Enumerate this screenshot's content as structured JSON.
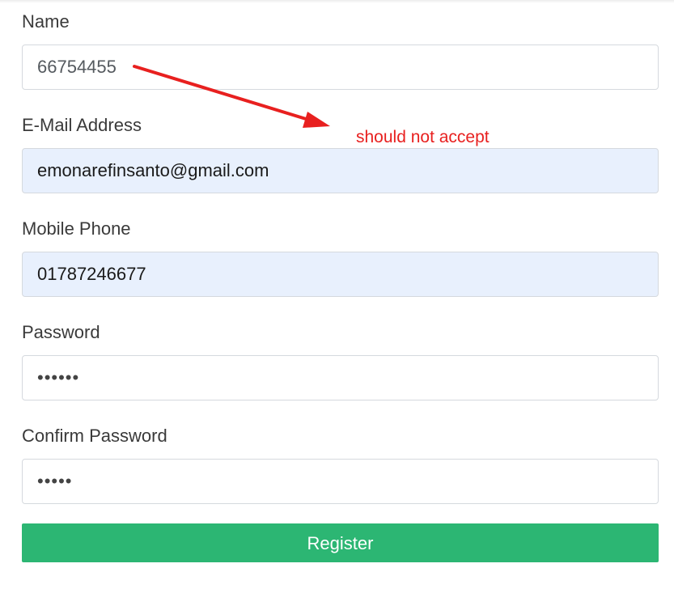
{
  "form": {
    "name": {
      "label": "Name",
      "value": "66754455"
    },
    "email": {
      "label": "E-Mail Address",
      "value": "emonarefinsanto@gmail.com"
    },
    "phone": {
      "label": "Mobile Phone",
      "value": "01787246677"
    },
    "password": {
      "label": "Password",
      "value": "••••••"
    },
    "confirm_password": {
      "label": "Confirm Password",
      "value": "•••••"
    },
    "submit_label": "Register"
  },
  "annotation": {
    "text": "should not accept",
    "color": "#e8201f"
  },
  "colors": {
    "button": "#2cb673",
    "autofill_bg": "#e8f0fd"
  }
}
